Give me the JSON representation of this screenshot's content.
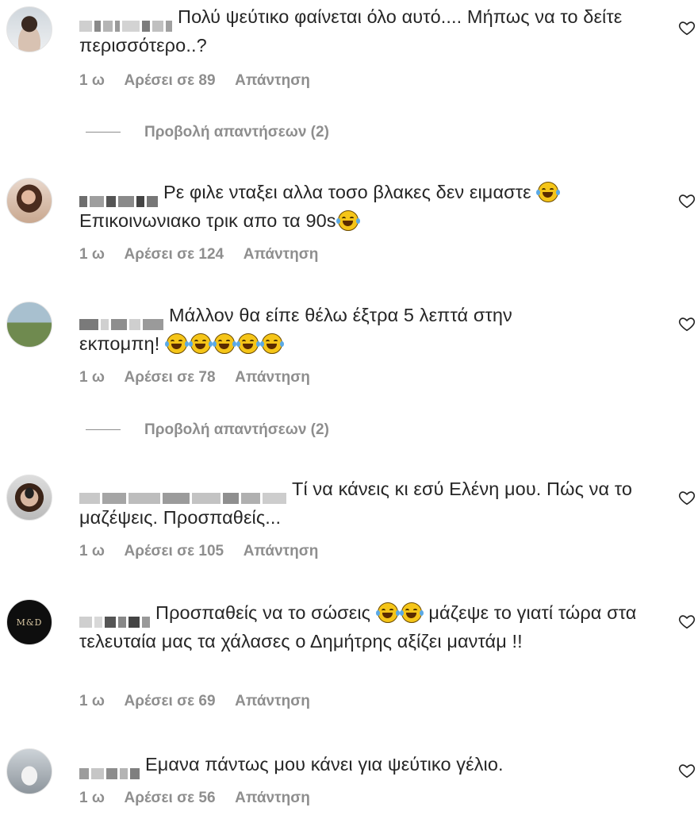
{
  "comments": [
    {
      "text": "Πολύ ψεύτικο φαίνεται όλο αυτό.... Μήπως να το δείτε περισσότερο..?",
      "time": "1 ω",
      "likes": "Αρέσει σε 89",
      "reply": "Απάντηση",
      "view_replies": "Προβολή απαντήσεων (2)"
    },
    {
      "text_a": "Ρε φιλε νταξει αλλα τοσο βλακες δεν ειμαστε",
      "text_b": "Επικοινωνιακο τρικ απο τα 90s",
      "time": "1 ω",
      "likes": "Αρέσει σε 124",
      "reply": "Απάντηση"
    },
    {
      "text_a": "Μάλλον θα είπε θέλω έξτρα 5 λεπτά στην",
      "text_b": "εκπομπη!",
      "time": "1 ω",
      "likes": "Αρέσει σε 78",
      "reply": "Απάντηση",
      "view_replies": "Προβολή απαντήσεων (2)"
    },
    {
      "text": "Τί να κάνεις κι εσύ Ελένη μου. Πώς να το μαζέψεις. Προσπαθείς...",
      "time": "1 ω",
      "likes": "Αρέσει σε 105",
      "reply": "Απάντηση"
    },
    {
      "text_a": "Προσπαθείς να το σώσεις",
      "text_b": "μάζεψε το γιατί τώρα στα τελευταία μας τα χάλασες ο Δημήτρης αξίζει μαντάμ !!",
      "avatar_text": "M&D",
      "time": "1 ω",
      "likes": "Αρέσει σε 69",
      "reply": "Απάντηση"
    },
    {
      "text": "Εμανα πάντως μου κάνει για ψεύτικο γέλιο.",
      "time": "1 ω",
      "likes": "Αρέσει σε 56",
      "reply": "Απάντηση"
    }
  ],
  "icons": {
    "heart": "heart-outline-icon",
    "emoji": "tears-of-joy-emoji"
  },
  "colors": {
    "text": "#262626",
    "secondary": "#8e8e8e",
    "background": "#ffffff"
  }
}
